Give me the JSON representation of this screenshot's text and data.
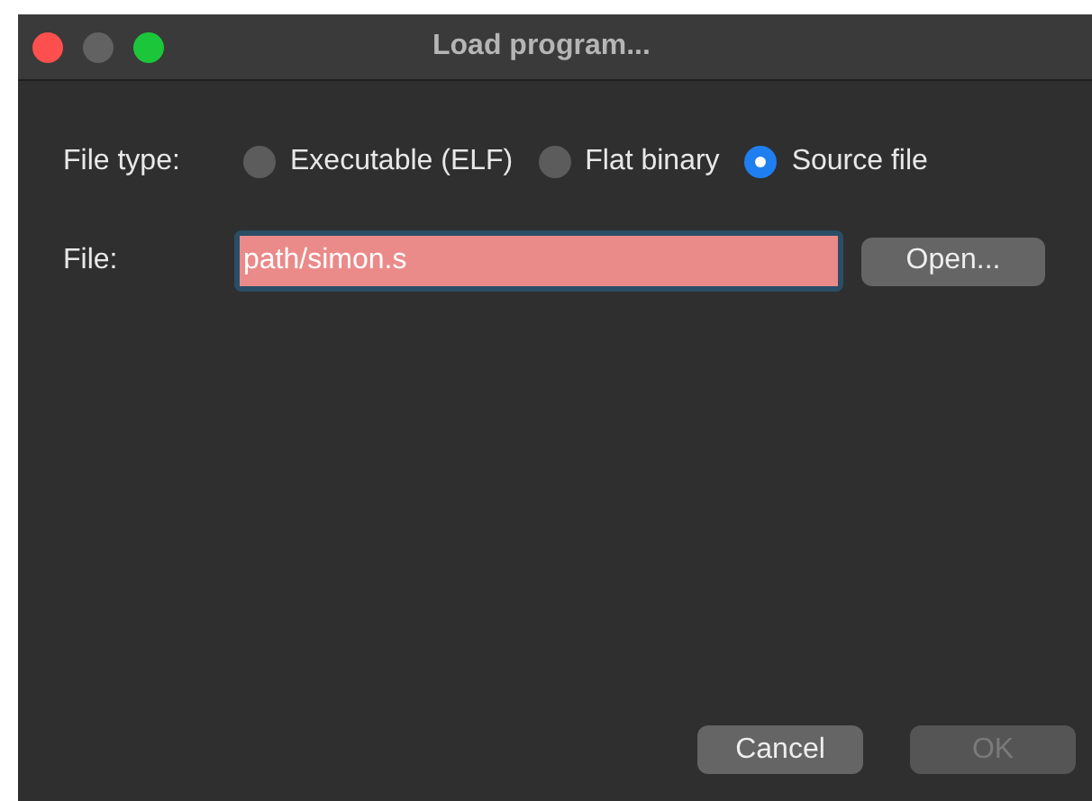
{
  "window": {
    "title": "Load program..."
  },
  "file_type": {
    "label": "File type:",
    "options": [
      {
        "label": "Executable (ELF)",
        "selected": false
      },
      {
        "label": "Flat binary",
        "selected": false
      },
      {
        "label": "Source file",
        "selected": true
      }
    ]
  },
  "file": {
    "label": "File:",
    "value": "path/simon.s",
    "invalid": true,
    "open_button": "Open..."
  },
  "buttons": [
    {
      "label": "Cancel",
      "disabled": false
    },
    {
      "label": "OK",
      "disabled": true
    }
  ]
}
